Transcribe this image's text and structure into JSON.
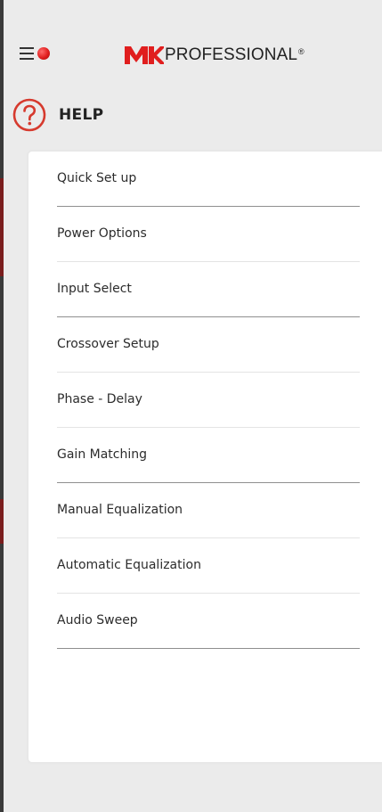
{
  "header": {
    "menu_icon": "hamburger-icon",
    "notification_indicator": "red-dot",
    "brand_logo_text": "MK",
    "brand_name": "PROFESSIONAL",
    "brand_registered": "®"
  },
  "help": {
    "icon": "question-circle-icon",
    "title": "HELP",
    "items": [
      {
        "label": "Quick Set up",
        "divider": "strong"
      },
      {
        "label": "Power Options",
        "divider": "light"
      },
      {
        "label": "Input Select",
        "divider": "strong"
      },
      {
        "label": "Crossover Setup",
        "divider": "light"
      },
      {
        "label": "Phase - Delay",
        "divider": "light"
      },
      {
        "label": "Gain Matching",
        "divider": "strong"
      },
      {
        "label": "Manual Equalization",
        "divider": "light"
      },
      {
        "label": "Automatic Equalization",
        "divider": "light"
      },
      {
        "label": "Audio Sweep",
        "divider": "strong"
      }
    ]
  },
  "colors": {
    "brand_red": "#e01e1e",
    "help_icon_red": "#d63a2e",
    "background": "#ebebeb",
    "panel": "#ffffff",
    "text": "#2c2c2c"
  }
}
